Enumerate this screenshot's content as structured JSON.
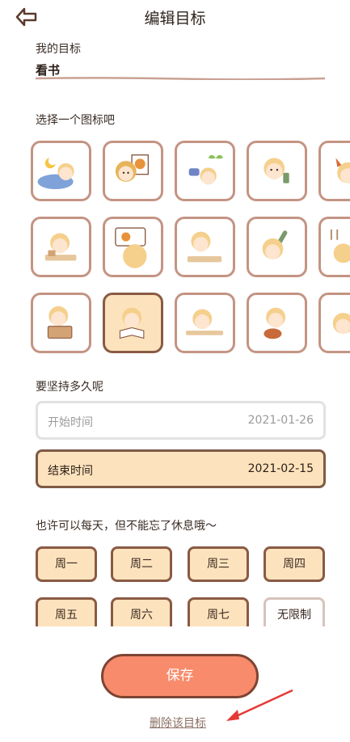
{
  "header": {
    "title": "编辑目标",
    "back_icon": "back-arrow-icon"
  },
  "goal": {
    "label": "我的目标",
    "value": "看书"
  },
  "icons": {
    "label": "选择一个图标吧",
    "items": [
      {
        "name": "sleeping-moon-icon",
        "selected": false
      },
      {
        "name": "lion-painting-icon",
        "selected": false
      },
      {
        "name": "planting-seedling-icon",
        "selected": false
      },
      {
        "name": "boy-eating-icon",
        "selected": false
      },
      {
        "name": "cooking-pot-icon",
        "selected": false
      },
      {
        "name": "study-desk-icon",
        "selected": false
      },
      {
        "name": "computer-fox-screen-icon",
        "selected": false
      },
      {
        "name": "lying-phone-icon",
        "selected": false
      },
      {
        "name": "boy-music-icon",
        "selected": false
      },
      {
        "name": "ladder-icon",
        "selected": false
      },
      {
        "name": "carrying-box-icon",
        "selected": false
      },
      {
        "name": "reading-book-icon",
        "selected": true
      },
      {
        "name": "writing-desk-icon",
        "selected": false
      },
      {
        "name": "playing-guitar-icon",
        "selected": false
      },
      {
        "name": "partial-child-icon",
        "selected": false
      }
    ]
  },
  "duration": {
    "label": "要坚持多久呢",
    "start": {
      "label": "开始时间",
      "value": "2021-01-26"
    },
    "end": {
      "label": "结束时间",
      "value": "2021-02-15"
    }
  },
  "days": {
    "label": "也许可以每天，但不能忘了休息哦～",
    "items": [
      {
        "label": "周一",
        "active": true
      },
      {
        "label": "周二",
        "active": true
      },
      {
        "label": "周三",
        "active": true
      },
      {
        "label": "周四",
        "active": true
      },
      {
        "label": "周五",
        "active": true
      },
      {
        "label": "周六",
        "active": true
      },
      {
        "label": "周七",
        "active": true
      },
      {
        "label": "无限制",
        "active": false
      }
    ]
  },
  "actions": {
    "save_label": "保存",
    "delete_label": "删除该目标"
  },
  "colors": {
    "accent": "#f78b6c",
    "selected_bg": "#fde3bd",
    "border": "#c49483",
    "dark_border": "#8a5a44",
    "annotation": "#e53935"
  }
}
